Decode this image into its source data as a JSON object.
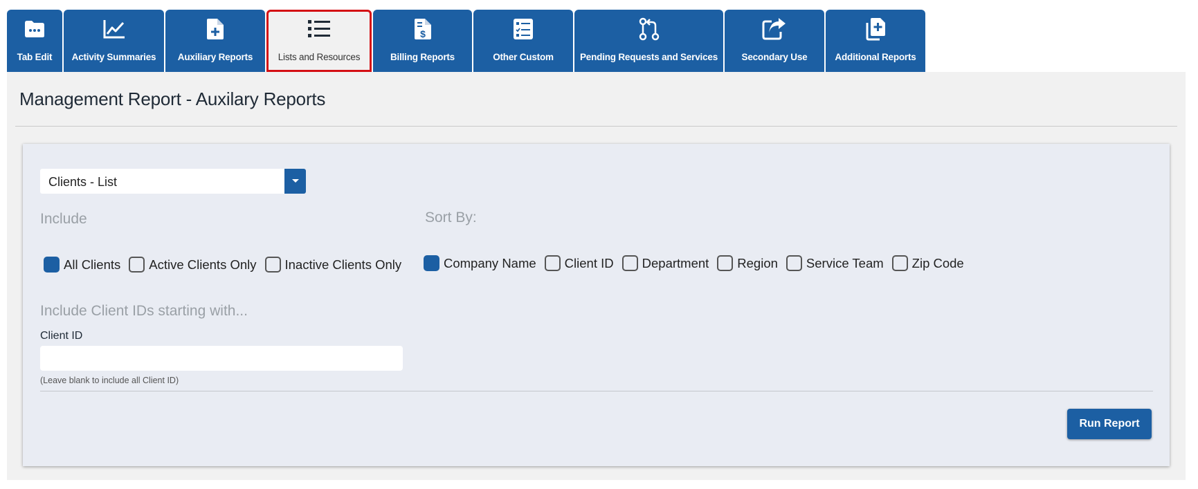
{
  "tabs": [
    {
      "label": "Tab Edit",
      "icon": "folder-icon"
    },
    {
      "label": "Activity Summaries",
      "icon": "line-chart-icon"
    },
    {
      "label": "Auxiliary Reports",
      "icon": "file-plus-icon"
    },
    {
      "label": "Lists and Resources",
      "icon": "list-icon",
      "active": true
    },
    {
      "label": "Billing Reports",
      "icon": "file-dollar-icon"
    },
    {
      "label": "Other Custom",
      "icon": "checklist-icon"
    },
    {
      "label": "Pending Requests and Services",
      "icon": "pull-request-icon"
    },
    {
      "label": "Secondary Use",
      "icon": "share-icon"
    },
    {
      "label": "Additional Reports",
      "icon": "copy-plus-icon"
    }
  ],
  "page": {
    "title": "Management Report - Auxilary Reports"
  },
  "report_select": {
    "value": "Clients - List"
  },
  "include": {
    "label": "Include",
    "options": [
      {
        "label": "All Clients",
        "checked": true
      },
      {
        "label": "Active Clients Only",
        "checked": false
      },
      {
        "label": "Inactive Clients Only",
        "checked": false
      }
    ]
  },
  "sort_by": {
    "label": "Sort By:",
    "options": [
      {
        "label": "Company Name",
        "checked": true
      },
      {
        "label": "Client ID",
        "checked": false
      },
      {
        "label": "Department",
        "checked": false
      },
      {
        "label": "Region",
        "checked": false
      },
      {
        "label": "Service Team",
        "checked": false
      },
      {
        "label": "Zip Code",
        "checked": false
      }
    ]
  },
  "client_filter": {
    "heading": "Include Client IDs starting with...",
    "field_label": "Client ID",
    "value": "",
    "hint": "(Leave blank to include all Client ID)"
  },
  "actions": {
    "run_label": "Run Report"
  },
  "colors": {
    "accent": "#1c5fa3",
    "active_tab_border": "#d40f14",
    "panel_bg": "#f1f1f1",
    "card_bg": "#e9ecf3"
  }
}
